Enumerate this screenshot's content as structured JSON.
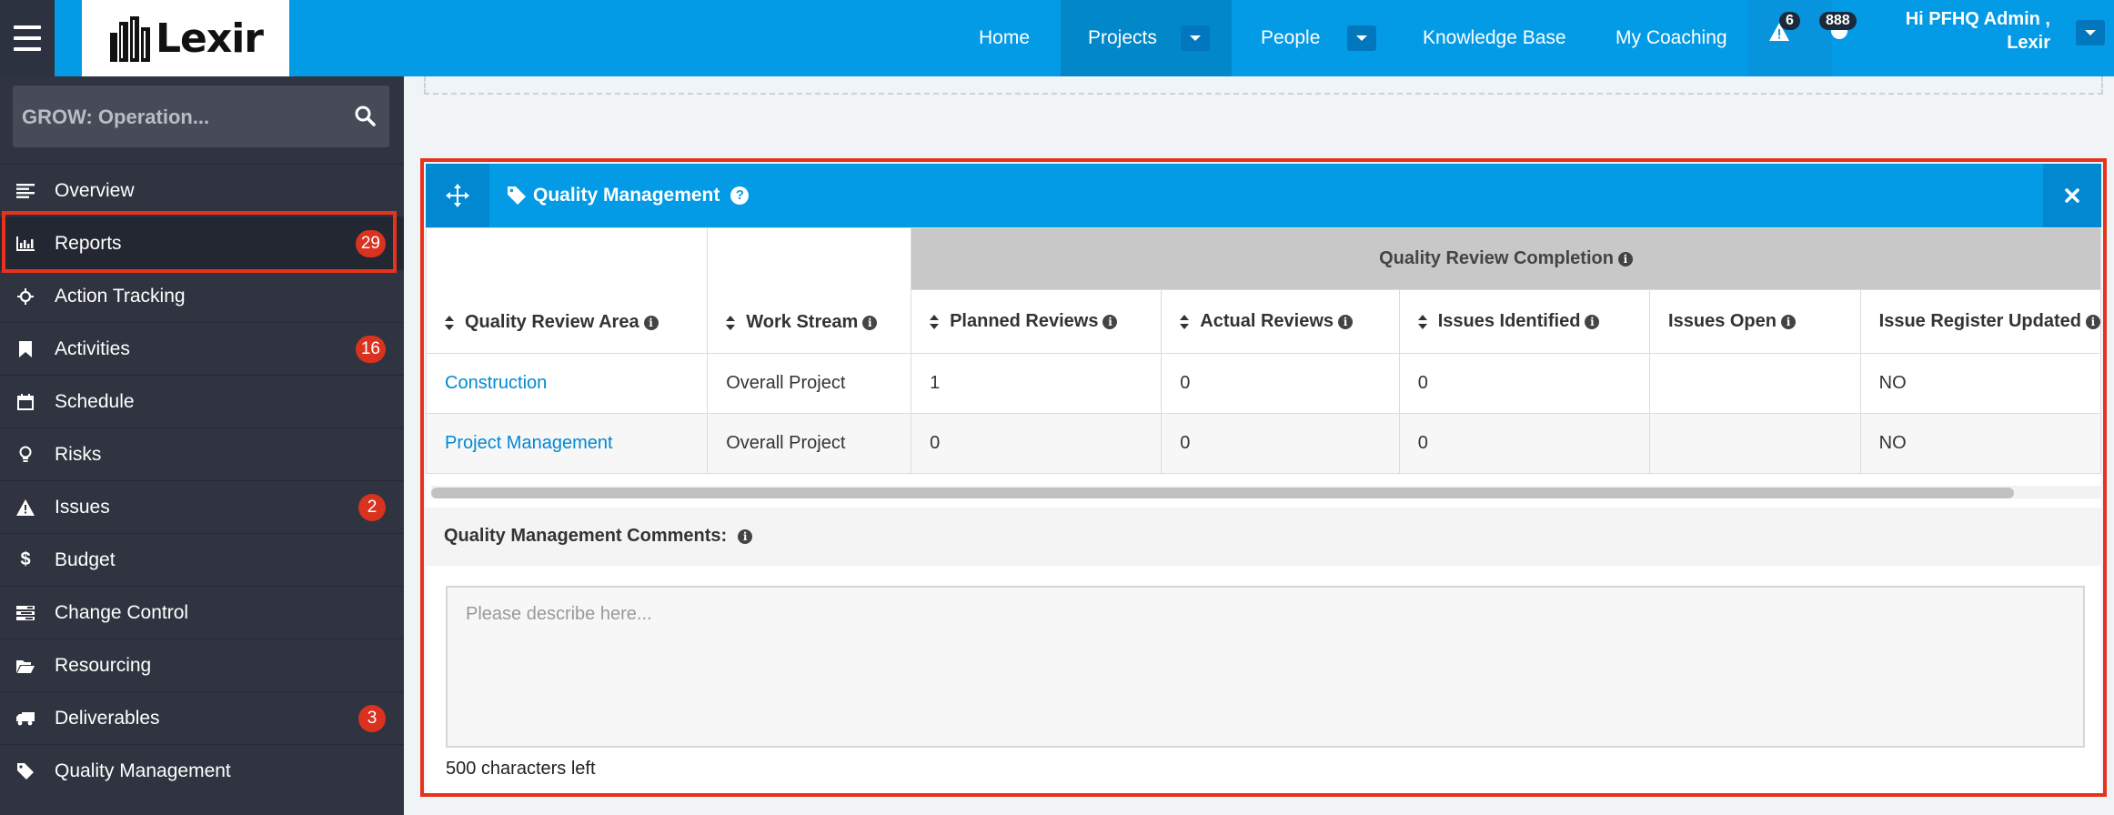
{
  "colors": {
    "brand": "#039be5",
    "sidebar_bg": "#2f3440",
    "badge": "#d9321e",
    "highlight": "#e8321e",
    "link": "#0288d1"
  },
  "logo": {
    "text": "Lexir"
  },
  "nav": {
    "home": "Home",
    "projects": "Projects",
    "people": "People",
    "knowledge_base": "Knowledge Base",
    "my_coaching": "My Coaching",
    "alerts_count": "6",
    "messages_count": "888",
    "user_line1": "Hi PFHQ Admin ,",
    "user_line2": "Lexir"
  },
  "sidebar": {
    "search_text": "GROW: Operation...",
    "items": [
      {
        "label": "Overview",
        "icon": "align-left-icon",
        "badge": ""
      },
      {
        "label": "Reports",
        "icon": "bar-chart-icon",
        "badge": "29"
      },
      {
        "label": "Action Tracking",
        "icon": "crosshair-icon",
        "badge": ""
      },
      {
        "label": "Activities",
        "icon": "bookmark-icon",
        "badge": "16"
      },
      {
        "label": "Schedule",
        "icon": "calendar-icon",
        "badge": ""
      },
      {
        "label": "Risks",
        "icon": "lightbulb-icon",
        "badge": ""
      },
      {
        "label": "Issues",
        "icon": "warning-icon",
        "badge": "2"
      },
      {
        "label": "Budget",
        "icon": "dollar-icon",
        "badge": ""
      },
      {
        "label": "Change Control",
        "icon": "tasks-icon",
        "badge": ""
      },
      {
        "label": "Resourcing",
        "icon": "folder-open-icon",
        "badge": ""
      },
      {
        "label": "Deliverables",
        "icon": "truck-icon",
        "badge": "3"
      },
      {
        "label": "Quality Management",
        "icon": "tag-icon",
        "badge": ""
      }
    ]
  },
  "panel": {
    "title": "Quality Management",
    "group_header": "Quality Review Completion",
    "columns": [
      "Quality Review Area",
      "Work Stream",
      "Planned Reviews",
      "Actual Reviews",
      "Issues Identified",
      "Issues Open",
      "Issue Register Updated"
    ],
    "rows": [
      [
        "Construction",
        "Overall Project",
        "1",
        "0",
        "0",
        "",
        "NO"
      ],
      [
        "Project Management",
        "Overall Project",
        "0",
        "0",
        "0",
        "",
        "NO"
      ]
    ],
    "comments_label": "Quality Management Comments:",
    "comments_placeholder": "Please describe here...",
    "chars_left": "500 characters left"
  }
}
